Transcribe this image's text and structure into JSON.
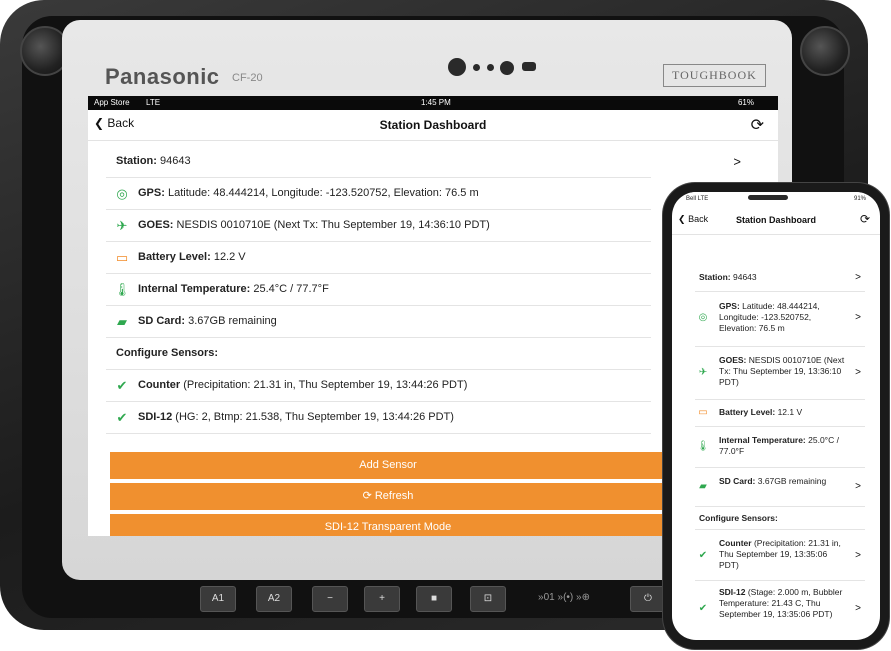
{
  "tablet": {
    "brand": "Panasonic",
    "model": "CF-20",
    "toughbook": "TOUGHBOOK",
    "statusbar": {
      "left": "App Store",
      "signal": "LTE",
      "time": "1:45 PM",
      "battery": "61%"
    },
    "nav": {
      "back": "Back",
      "title": "Station Dashboard"
    },
    "rows": [
      {
        "label": "Station:",
        "value": " 94643",
        "chevron": ">"
      },
      {
        "icon": "gps-icon",
        "label": "GPS:",
        "value": " Latitude: 48.444214, Longitude: -123.520752, Elevation: 76.5 m"
      },
      {
        "icon": "satellite-icon",
        "label": "GOES:",
        "value": " NESDIS 0010710E (Next Tx: Thu September 19, 14:36:10 PDT)"
      },
      {
        "icon": "battery-icon",
        "label": "Battery Level:",
        "value": " 12.2 V"
      },
      {
        "icon": "thermometer-icon",
        "label": "Internal Temperature:",
        "value": " 25.4°C / 77.7°F"
      },
      {
        "icon": "sd-card-icon",
        "label": "SD Card:",
        "value": " 3.67GB remaining"
      },
      {
        "label": "Configure Sensors:",
        "value": ""
      },
      {
        "icon": "check-circle-icon",
        "label": "Counter",
        "value": " (Precipitation: 21.31 in, Thu September 19, 13:44:26 PDT)"
      },
      {
        "icon": "check-circle-icon",
        "label": "SDI-12",
        "value": " (HG: 2, Btmp: 21.538, Thu September 19, 13:44:26 PDT)"
      }
    ],
    "buttons": [
      "Add Sensor",
      "⟳ Refresh",
      "SDI-12 Transparent Mode"
    ],
    "hw_buttons": [
      "A1",
      "A2",
      "−",
      "+",
      "■",
      "⊡",
      "»01 »(•) »⊕",
      "⏻"
    ]
  },
  "phone": {
    "statusbar": {
      "carrier": "Bell LTE",
      "time": "1:35 PM",
      "battery": "91%"
    },
    "nav": {
      "back": "Back",
      "title": "Station Dashboard"
    },
    "rows": [
      {
        "label": "Station:",
        "value": " 94643",
        "chevron": ">"
      },
      {
        "icon": "gps-icon",
        "label": "GPS:",
        "value": " Latitude: 48.444214, Longitude: -123.520752, Elevation: 76.5 m",
        "chevron": ">"
      },
      {
        "icon": "satellite-icon",
        "label": "GOES:",
        "value": " NESDIS 0010710E (Next Tx: Thu September 19, 13:36:10 PDT)",
        "chevron": ">"
      },
      {
        "icon": "battery-icon",
        "label": "Battery Level:",
        "value": " 12.1 V"
      },
      {
        "icon": "thermometer-icon",
        "label": "Internal Temperature:",
        "value": " 25.0°C / 77.0°F"
      },
      {
        "icon": "sd-card-icon",
        "label": "SD Card:",
        "value": " 3.67GB remaining",
        "chevron": ">"
      },
      {
        "label": "Configure Sensors:",
        "value": ""
      },
      {
        "icon": "check-circle-icon",
        "label": "Counter",
        "value": " (Precipitation: 21.31 in, Thu September 19, 13:35:06 PDT)",
        "chevron": ">"
      },
      {
        "icon": "check-circle-icon",
        "label": "SDI-12",
        "value": " (Stage: 2.000 m, Bubbler Temperature: 21.43 C, Thu September 19, 13:35:06 PDT)",
        "chevron": ">"
      }
    ]
  },
  "colors": {
    "accent": "#f0902f",
    "ok": "#2fa84f",
    "battery": "#f28c28"
  }
}
